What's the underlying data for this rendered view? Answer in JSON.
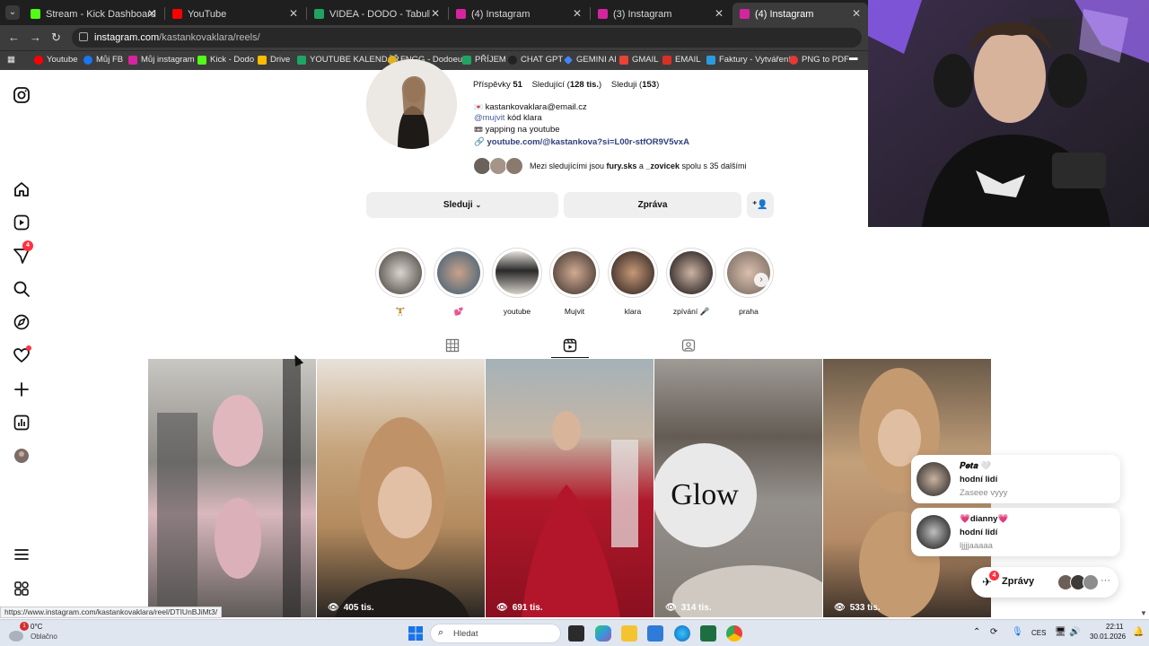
{
  "browser": {
    "tabs": [
      {
        "title": "Stream - Kick Dashboard",
        "color": "#53fc18"
      },
      {
        "title": "YouTube",
        "color": "#ff0000"
      },
      {
        "title": "VIDEA - DODO - Tabulky Goog",
        "color": "#1fa463"
      },
      {
        "title": "(4) Instagram",
        "color": "#d6249f"
      },
      {
        "title": "(3) Instagram",
        "color": "#d6249f"
      },
      {
        "title": "(4) Instagram",
        "color": "#d6249f"
      }
    ],
    "url_host": "instagram.com",
    "url_path": "/kastankovaklara/reels/",
    "bookmarks": [
      {
        "label": "Youtube",
        "color": "#ff0000"
      },
      {
        "label": "Můj FB",
        "color": "#1877f2"
      },
      {
        "label": "Můj instagram",
        "color": "#d6249f"
      },
      {
        "label": "Kick - Dodo",
        "color": "#53fc18"
      },
      {
        "label": "Drive",
        "color": "#fbbc04"
      },
      {
        "label": "YOUTUBE KALENDÁŘ",
        "color": "#1fa463"
      },
      {
        "label": "FNGG - Dodoeu",
        "color": "#e0b020"
      },
      {
        "label": "PŘÍJEM",
        "color": "#1fa463"
      },
      {
        "label": "CHAT GPT",
        "color": "#222222"
      },
      {
        "label": "GEMINI AI",
        "color": "#4285f4"
      },
      {
        "label": "GMAIL",
        "color": "#ea4335"
      },
      {
        "label": "EMAIL",
        "color": "#d93025"
      },
      {
        "label": "Faktury - Vytváření",
        "color": "#2b9be0"
      },
      {
        "label": "PNG to PDF",
        "color": "#e53935"
      }
    ]
  },
  "rail": {
    "badge_count": "4"
  },
  "profile": {
    "posts_label": "Příspěvky",
    "posts_count": "51",
    "followers_label": "Sledující",
    "followers_count": "128 tis.",
    "following_label": "Sleduji",
    "following_count": "153",
    "email": "kastankovaklara@email.cz",
    "mention": "@mujvit",
    "mention_text": "kód klara",
    "bio_line": "yapping na youtube",
    "link": "youtube.com/@kastankova?si=L00r-stfOR9V5vxA",
    "followed_by_prefix": "Mezi sledujícími jsou",
    "followed_by_1": "fury.sks",
    "followed_by_and": "a",
    "followed_by_2": "_zovicek",
    "followed_by_suffix": "spolu s 35 dalšími",
    "btn_following": "Sleduji",
    "btn_message": "Zpráva"
  },
  "highlights": [
    {
      "label": "🏋",
      "color": "#9a8f86"
    },
    {
      "label": "💕",
      "color": "#c4a28a"
    },
    {
      "label": "youtube",
      "color": "#cfc9c0"
    },
    {
      "label": "Mujvit",
      "color": "#b09080"
    },
    {
      "label": "klara",
      "color": "#a57c62"
    },
    {
      "label": "zpívání 🎤",
      "color": "#8d7a70"
    },
    {
      "label": "praha",
      "color": "#b7a08f"
    }
  ],
  "reels": [
    {
      "views": "",
      "bg": "linear-gradient(180deg,#c9c7c2 0%,#8f8c88 40%,#d9b8be 60%,#5e5a58 100%)"
    },
    {
      "views": "405 tis.",
      "bg": "linear-gradient(180deg,#e8e2da 0%,#c6a47c 35%,#b38a5e 65%,#2a2622 100%)"
    },
    {
      "views": "691 tis.",
      "bg": "linear-gradient(180deg,#a5b2b8 0%,#c5b6a5 30%,#b0182a 55%,#8a1020 100%)"
    },
    {
      "views": "314 tis.",
      "bg": "linear-gradient(180deg,#f0efec 0%,#6d645c 30%,#d8d8d8 55%,#a8a29b 100%)"
    },
    {
      "views": "533 tis.",
      "bg": "linear-gradient(180deg,#6b5a49 0%,#c3a07a 40%,#b48b66 70%,#3c3028 100%)"
    }
  ],
  "messages": [
    {
      "name": "𝑷𝒆𝒕𝒂 🤍",
      "line2": "hodní lidí",
      "line3": "Zaseee vyyy"
    },
    {
      "name": "💗dianny💗",
      "line2": "hodní lidí",
      "line3": "ljjjjaaaaa"
    }
  ],
  "messages_button": {
    "label": "Zprávy",
    "badge": "4"
  },
  "status_url": "https://www.instagram.com/kastankovaklara/reel/DTIUnBJiMt3/",
  "taskbar": {
    "weather_temp": "0°C",
    "weather_text": "Oblačno",
    "weather_badge": "1",
    "search_placeholder": "Hledat",
    "lang": "CES",
    "time": "22:11",
    "date": "30.01.2026"
  }
}
